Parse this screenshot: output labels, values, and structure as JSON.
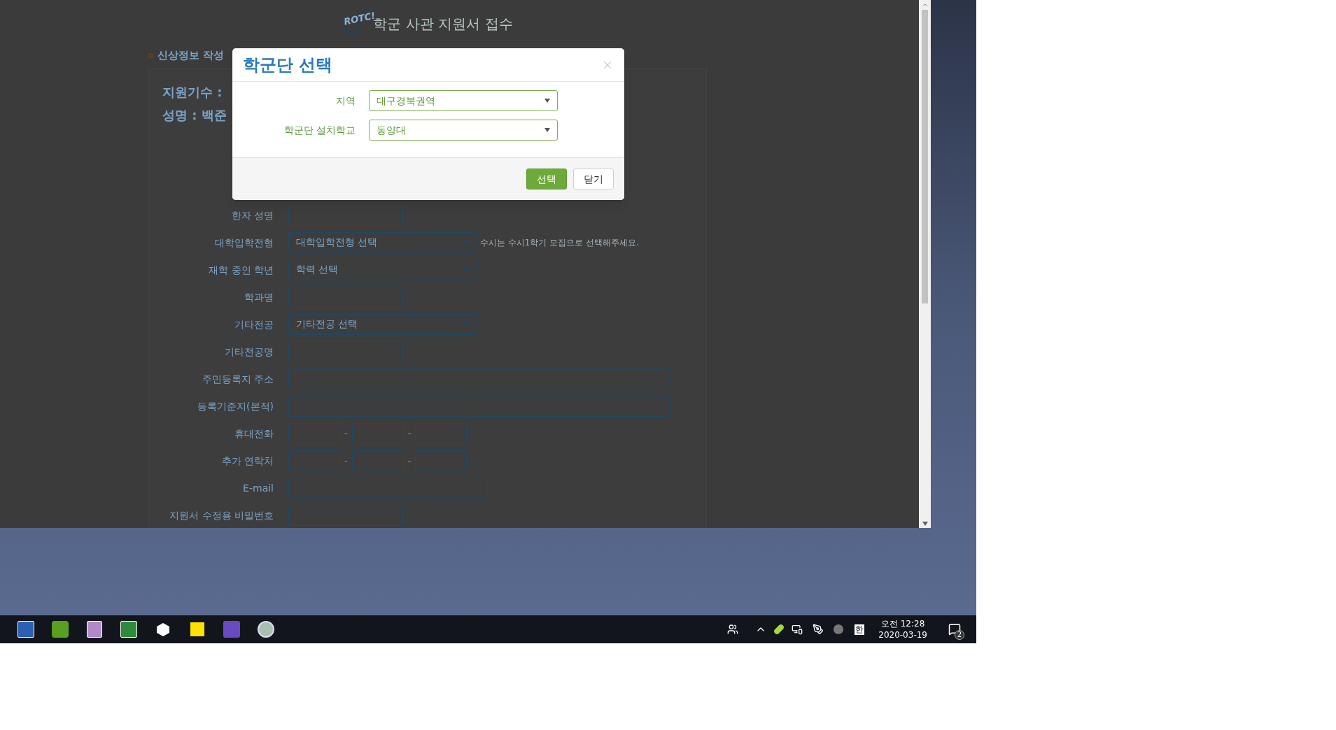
{
  "page": {
    "logo_text": "ROTC!",
    "title": "학군 사관 지원서 접수",
    "section": "신상정보 작성",
    "summary": [
      "지원기수 :",
      "성명 : 백준"
    ],
    "rows": [
      {
        "label": "한자 성명",
        "kind": "short"
      },
      {
        "label": "대학입학전형",
        "kind": "select",
        "value": "대학입학전형 선택",
        "note": "수시는 수시1학기 모집으로 선택해주세요."
      },
      {
        "label": "재학 중인 학년",
        "kind": "select",
        "value": "학력 선택"
      },
      {
        "label": "학과명",
        "kind": "short"
      },
      {
        "label": "기타전공",
        "kind": "select",
        "value": "기타전공 선택"
      },
      {
        "label": "기타전공명",
        "kind": "short"
      },
      {
        "label": "주민등록지 주소",
        "kind": "long"
      },
      {
        "label": "등록기준지(본적)",
        "kind": "long"
      },
      {
        "label": "휴대전화",
        "kind": "phone",
        "separators": [
          "-",
          "-"
        ]
      },
      {
        "label": "추가 연락처",
        "kind": "phone",
        "separators": [
          "-",
          "-"
        ]
      },
      {
        "label": "E-mail",
        "kind": "medium"
      },
      {
        "label": "지원서 수정용 비밀번호",
        "kind": "short"
      }
    ]
  },
  "modal": {
    "title": "학군단 선택",
    "fields": [
      {
        "label": "지역",
        "value": "대구경북권역"
      },
      {
        "label": "학군단 설치학교",
        "value": "동양대"
      }
    ],
    "buttons": [
      {
        "label": "선택",
        "kind": "primary"
      },
      {
        "label": "닫기",
        "kind": "default"
      }
    ]
  },
  "taskbar": {
    "ime": "한",
    "time": "오전 12:28",
    "date": "2020-03-19",
    "notifications": "2"
  }
}
